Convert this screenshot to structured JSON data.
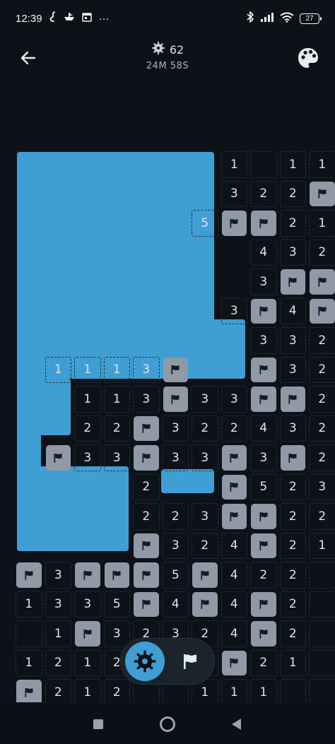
{
  "status_bar": {
    "time": "12:39",
    "left_icons": [
      "snake-notification-icon",
      "boat-notification-icon",
      "calendar-notification-icon",
      "more-dots-icon"
    ],
    "more": "···",
    "right_icons": [
      "bluetooth-icon",
      "signal-icon",
      "wifi-icon"
    ],
    "battery": "27"
  },
  "header": {
    "mine_count": "62",
    "timer": "24M 58S"
  },
  "board": {
    "cols": 11,
    "colors": {
      "background": "#0d1219",
      "revealed_region": "#3f9fd4",
      "flag_tile": "#8f9aa6",
      "number_text": "#dfe5ec"
    },
    "rows": [
      [
        "U",
        "U",
        "U",
        "U",
        "U",
        "U",
        "U",
        "1",
        "E",
        "1",
        "1"
      ],
      [
        "U",
        "U",
        "U",
        "U",
        "U",
        "U",
        "U",
        "3",
        "2",
        "2",
        "F"
      ],
      [
        "U",
        "U",
        "U",
        "U",
        "U",
        "U",
        "5",
        "F",
        "F",
        "2",
        "1"
      ],
      [
        "U",
        "U",
        "U",
        "U",
        "U",
        "U",
        "U",
        "U",
        "4",
        "3",
        "2"
      ],
      [
        "U",
        "U",
        "U",
        "U",
        "U",
        "U",
        "U",
        "U",
        "3",
        "F",
        "F"
      ],
      [
        "U",
        "U",
        "U",
        "U",
        "U",
        "U",
        "U",
        "3",
        "F",
        "4",
        "F"
      ],
      [
        "U",
        "U",
        "U",
        "U",
        "U",
        "U",
        "U",
        "U",
        "3",
        "3",
        "2"
      ],
      [
        "U",
        "1",
        "1",
        "1",
        "3",
        "F",
        "U",
        "U",
        "F",
        "3",
        "2"
      ],
      [
        "U",
        "U",
        "1",
        "1",
        "3",
        "F",
        "3",
        "3",
        "F",
        "F",
        "2"
      ],
      [
        "U",
        "U",
        "2",
        "2",
        "F",
        "3",
        "2",
        "2",
        "4",
        "3",
        "2"
      ],
      [
        "U",
        "F",
        "3",
        "3",
        "F",
        "3",
        "3",
        "F",
        "3",
        "F",
        "2"
      ],
      [
        "U",
        "U",
        "U",
        "U",
        "2",
        "U",
        "U",
        "F",
        "5",
        "2",
        "3"
      ],
      [
        "U",
        "U",
        "U",
        "U",
        "2",
        "2",
        "3",
        "F",
        "F",
        "2",
        "2"
      ],
      [
        "U",
        "U",
        "U",
        "U",
        "F",
        "3",
        "2",
        "4",
        "F",
        "2",
        "1"
      ],
      [
        "F",
        "3",
        "F",
        "F",
        "F",
        "5",
        "F",
        "4",
        "2",
        "2",
        "E"
      ],
      [
        "1",
        "3",
        "3",
        "5",
        "F",
        "4",
        "F",
        "4",
        "F",
        "2",
        "E"
      ],
      [
        "E",
        "1",
        "F",
        "3",
        "2",
        "3",
        "2",
        "4",
        "F",
        "2",
        "E"
      ],
      [
        "1",
        "2",
        "1",
        "2",
        "E",
        "E",
        "E",
        "F",
        "2",
        "1",
        "E"
      ],
      [
        "F",
        "2",
        "1",
        "2",
        "E",
        "E",
        "1",
        "1",
        "1",
        "E",
        "E"
      ]
    ]
  },
  "controls": {
    "active_mode": "reveal",
    "modes": [
      "reveal-mine-icon",
      "flag-icon"
    ]
  },
  "nav": {
    "buttons": [
      "recents-button",
      "home-button",
      "back-nav-button"
    ]
  }
}
